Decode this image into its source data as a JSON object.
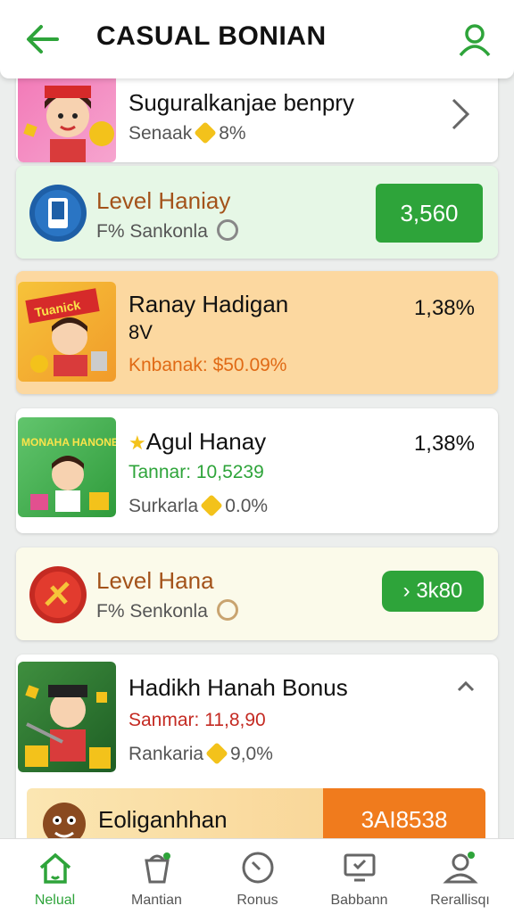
{
  "header": {
    "title": "CASUAL BONIAN"
  },
  "cards": [
    {
      "title": "Suguralkanjae benpry",
      "sub_label": "Senaak",
      "sub_value": "8%"
    },
    {
      "title": "Level Haniay",
      "sub": "F% Sankonla",
      "button": "3,560"
    },
    {
      "title": "Ranay Hadigan",
      "title2": "8V",
      "sub": "Knbanak: $50.09%",
      "pct": "1,38%",
      "thumb_text": "Tuanick"
    },
    {
      "title": "Agul Hanay",
      "value": "Tannar: 10,5239",
      "sub_label": "Surkarla",
      "sub_value": "0.0%",
      "pct": "1,38%",
      "thumb_text": "MONAHA HANONEY"
    },
    {
      "title": "Level Hana",
      "sub": "F% Senkonla",
      "button": "3k80"
    },
    {
      "title": "Hadikh Hanah Bonus",
      "value": "Sanmar: 11,8,90",
      "sub_label": "Rankaria",
      "sub_value": "9,0%"
    },
    {
      "title": "Eoliganhhan",
      "button": "3AI8538"
    }
  ],
  "tabs": [
    {
      "label": "Nelual",
      "icon": "home-icon"
    },
    {
      "label": "Mantian",
      "icon": "bucket-icon"
    },
    {
      "label": "Ronus",
      "icon": "clock-icon"
    },
    {
      "label": "Babbann",
      "icon": "monitor-icon"
    },
    {
      "label": "Rerallisqı",
      "icon": "user-icon"
    }
  ],
  "colors": {
    "accent": "#2ea43a",
    "orange": "#f07b1d",
    "brown": "#a3521a",
    "red": "#c42a22"
  }
}
